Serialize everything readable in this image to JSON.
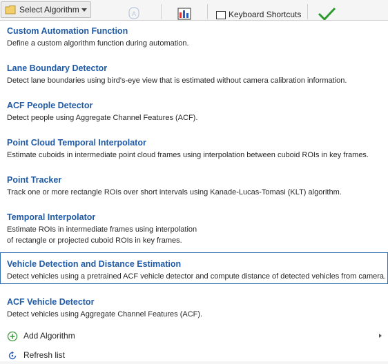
{
  "toolbar": {
    "select_algorithm_label": "Select Algorithm",
    "keyboard_shortcuts_label": "Keyboard Shortcuts",
    "icons": [
      "folder-icon",
      "chevron-down-icon",
      "automate-icon",
      "view-icon",
      "keyboard-icon",
      "checkmark-icon"
    ]
  },
  "menu": {
    "items": [
      {
        "title": "Custom Automation Function",
        "desc": "Define a custom algorithm function during automation."
      },
      {
        "title": "Lane Boundary Detector",
        "desc": "Detect lane boundaries using bird's-eye view that is estimated without camera calibration information."
      },
      {
        "title": "ACF People Detector",
        "desc": "Detect people using Aggregate Channel Features (ACF)."
      },
      {
        "title": "Point Cloud Temporal Interpolator",
        "desc": "Estimate cuboids in intermediate point cloud frames using interpolation between cuboid ROIs in key frames."
      },
      {
        "title": "Point Tracker",
        "desc": "Track one or more rectangle ROIs over short intervals using Kanade-Lucas-Tomasi (KLT) algorithm."
      },
      {
        "title": "Temporal Interpolator",
        "desc": "Estimate ROIs in intermediate frames using interpolation",
        "desc2": "of rectangle or projected cuboid ROIs in key frames."
      },
      {
        "title": "Vehicle Detection and Distance Estimation",
        "desc": "Detect vehicles using a pretrained ACF vehicle detector and compute distance of detected vehicles from camera.",
        "selected": true
      },
      {
        "title": "ACF Vehicle Detector",
        "desc": "Detect vehicles using Aggregate Channel Features (ACF)."
      }
    ],
    "actions": [
      {
        "label": "Add Algorithm",
        "icon": "add-circle-icon",
        "submenu": true
      },
      {
        "label": "Refresh list",
        "icon": "refresh-icon",
        "submenu": false
      }
    ]
  },
  "colors": {
    "title_blue": "#1f5aa6",
    "selection_border": "#2f6fb0",
    "add_green": "#3a9a3a",
    "check_green": "#2e9a2e"
  }
}
